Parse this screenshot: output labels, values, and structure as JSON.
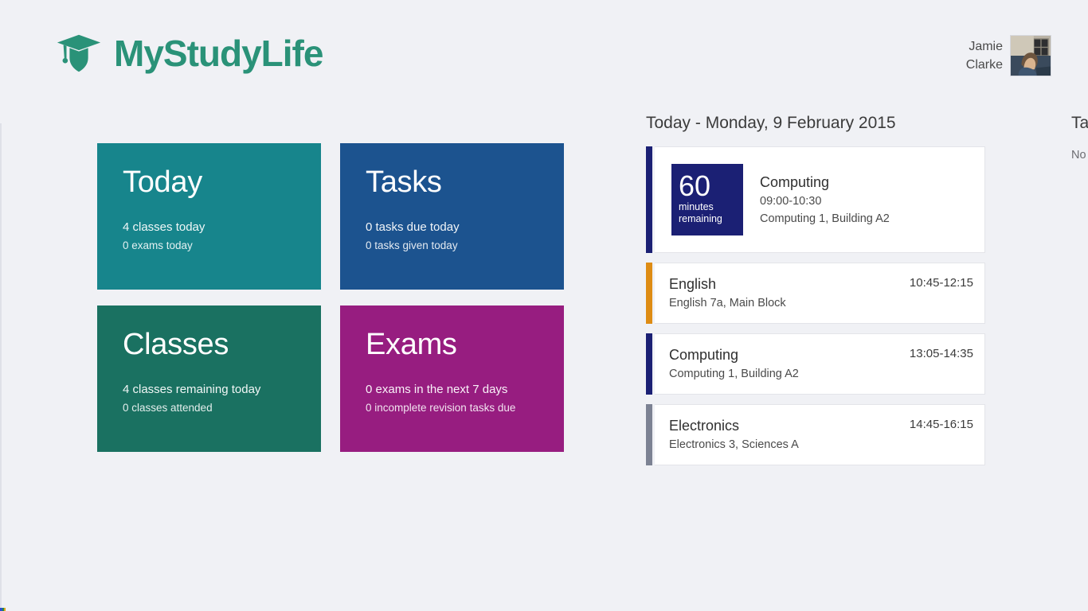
{
  "app": {
    "brand_name": "MyStudyLife",
    "brand_color": "#2a9278",
    "logo_icon": "graduation-cap-shield-icon",
    "background_color": "#f0f1f5"
  },
  "user": {
    "first_name": "Jamie",
    "last_name": "Clarke",
    "avatar_icon": "user-photo-avatar"
  },
  "tiles": [
    {
      "title": "Today",
      "line1": "4 classes today",
      "line2": "0 exams today",
      "color": "#17858c"
    },
    {
      "title": "Tasks",
      "line1": "0 tasks due today",
      "line2": "0 tasks given today",
      "color": "#1c538f"
    },
    {
      "title": "Classes",
      "line1": "4 classes remaining today",
      "line2": "0 classes attended",
      "color": "#1a7161"
    },
    {
      "title": "Exams",
      "line1": "0 exams in the next 7 days",
      "line2": "0 incomplete revision tasks due",
      "color": "#971d80"
    }
  ],
  "schedule": {
    "heading": "Today - Monday, 9 February 2015",
    "events": [
      {
        "name": "Computing",
        "time": "09:00-10:30",
        "location": "Computing 1, Building A2",
        "bar_color": "#1b2074",
        "current": true,
        "badge_number": "60",
        "badge_label_line1": "minutes",
        "badge_label_line2": "remaining",
        "badge_color": "#1b2074"
      },
      {
        "name": "English",
        "time": "10:45-12:15",
        "location": "English 7a, Main Block",
        "bar_color": "#de8c14",
        "current": false
      },
      {
        "name": "Computing",
        "time": "13:05-14:35",
        "location": "Computing 1, Building A2",
        "bar_color": "#1b2074",
        "current": false
      },
      {
        "name": "Electronics",
        "time": "14:45-16:15",
        "location": "Electronics 3, Sciences A",
        "bar_color": "#7c8293",
        "current": false
      }
    ]
  },
  "next_column": {
    "heading": "Tasks",
    "subtext": "No tasks"
  }
}
